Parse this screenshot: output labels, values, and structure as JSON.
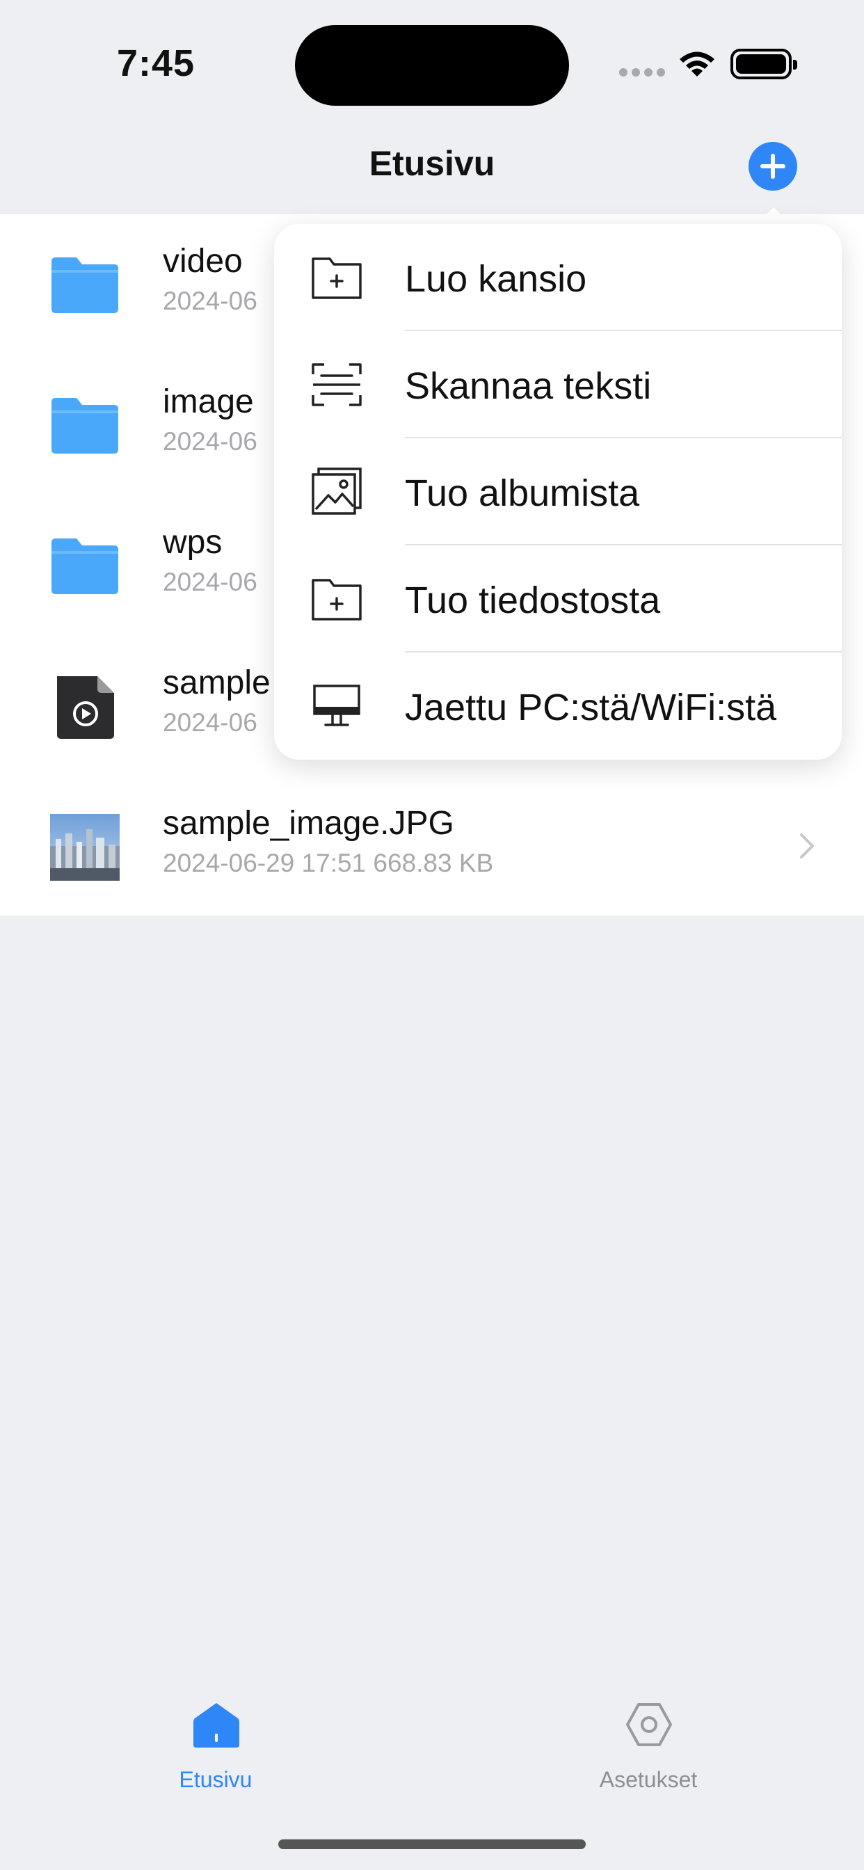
{
  "status_bar": {
    "time": "7:45"
  },
  "nav": {
    "title": "Etusivu"
  },
  "files": [
    {
      "name": "video",
      "meta": "2024-06",
      "type": "folder"
    },
    {
      "name": "image",
      "meta": "2024-06",
      "type": "folder"
    },
    {
      "name": "wps",
      "meta": "2024-06",
      "type": "folder"
    },
    {
      "name": "sample",
      "meta": "2024-06",
      "type": "video"
    },
    {
      "name": "sample_image.JPG",
      "meta": "2024-06-29 17:51  668.83 KB",
      "type": "image"
    }
  ],
  "menu": {
    "items": [
      {
        "label": "Luo kansio",
        "icon": "folder-plus-icon"
      },
      {
        "label": "Skannaa teksti",
        "icon": "scan-text-icon"
      },
      {
        "label": "Tuo albumista",
        "icon": "photo-album-icon"
      },
      {
        "label": "Tuo tiedostosta",
        "icon": "file-import-icon"
      },
      {
        "label": "Jaettu PC:stä/WiFi:stä",
        "icon": "monitor-icon"
      }
    ]
  },
  "tabs": [
    {
      "label": "Etusivu",
      "active": true
    },
    {
      "label": "Asetukset",
      "active": false
    }
  ],
  "colors": {
    "accent": "#2f86f6",
    "folder": "#4aa8fb",
    "muted": "#a8a8ac",
    "background": "#eeeff3"
  }
}
